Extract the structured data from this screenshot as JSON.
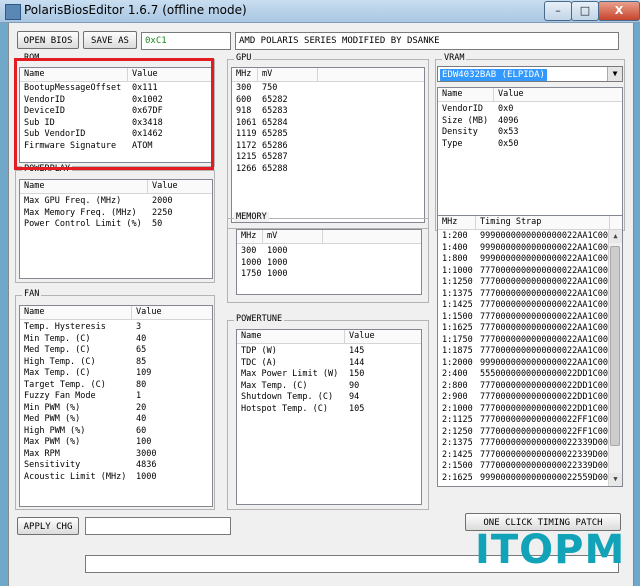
{
  "window": {
    "title": "PolarisBiosEditor 1.6.7 (offline mode)",
    "min": "–",
    "max": "□",
    "close": "X"
  },
  "toolbar": {
    "open_bios": "OPEN BIOS",
    "save_as": "SAVE AS",
    "checksum": "0xC1",
    "bios_name": "AMD POLARIS SERIES MODIFIED BY DSANKE"
  },
  "groups": {
    "rom": "ROM",
    "powerplay": "POWERPLAY",
    "fan": "FAN",
    "gpu": "GPU",
    "memory": "MEMORY",
    "powertune": "POWERTUNE",
    "vram": "VRAM"
  },
  "rom": {
    "headers": [
      "Name",
      "Value"
    ],
    "rows": [
      [
        "BootupMessageOffset",
        "0x111"
      ],
      [
        "VendorID",
        "0x1002"
      ],
      [
        "DeviceID",
        "0x67DF"
      ],
      [
        "Sub ID",
        "0x3418"
      ],
      [
        "Sub VendorID",
        "0x1462"
      ],
      [
        "Firmware Signature",
        "ATOM"
      ]
    ]
  },
  "powerplay": {
    "headers": [
      "Name",
      "Value"
    ],
    "rows": [
      [
        "Max GPU Freq. (MHz)",
        "2000"
      ],
      [
        "Max Memory Freq. (MHz)",
        "2250"
      ],
      [
        "Power Control Limit (%)",
        "50"
      ]
    ]
  },
  "fan": {
    "headers": [
      "Name",
      "Value"
    ],
    "rows": [
      [
        "Temp. Hysteresis",
        "3"
      ],
      [
        "Min Temp. (C)",
        "40"
      ],
      [
        "Med Temp. (C)",
        "65"
      ],
      [
        "High Temp. (C)",
        "85"
      ],
      [
        "Max Temp. (C)",
        "109"
      ],
      [
        "Target Temp. (C)",
        "80"
      ],
      [
        "Fuzzy Fan Mode",
        "1"
      ],
      [
        "Min PWM (%)",
        "20"
      ],
      [
        "Med PWM (%)",
        "40"
      ],
      [
        "High PWM (%)",
        "60"
      ],
      [
        "Max PWM (%)",
        "100"
      ],
      [
        "Max RPM",
        "3000"
      ],
      [
        "Sensitivity",
        "4836"
      ],
      [
        "Acoustic Limit (MHz)",
        "1000"
      ]
    ]
  },
  "gpu": {
    "headers": [
      "MHz",
      "mV"
    ],
    "rows": [
      [
        "300",
        "750"
      ],
      [
        "600",
        "65282"
      ],
      [
        "918",
        "65283"
      ],
      [
        "1061",
        "65284"
      ],
      [
        "1119",
        "65285"
      ],
      [
        "1172",
        "65286"
      ],
      [
        "1215",
        "65287"
      ],
      [
        "1266",
        "65288"
      ]
    ]
  },
  "memory": {
    "headers": [
      "MHz",
      "mV"
    ],
    "rows": [
      [
        "300",
        "1000"
      ],
      [
        "1000",
        "1000"
      ],
      [
        "1750",
        "1000"
      ]
    ]
  },
  "powertune": {
    "headers": [
      "Name",
      "Value"
    ],
    "rows": [
      [
        "TDP (W)",
        "145"
      ],
      [
        "TDC (A)",
        "144"
      ],
      [
        "Max Power Limit (W)",
        "150"
      ],
      [
        "Max Temp. (C)",
        "90"
      ],
      [
        "Shutdown Temp. (C)",
        "94"
      ],
      [
        "Hotspot Temp. (C)",
        "105"
      ]
    ]
  },
  "vram": {
    "selected": "EDW4032BAB (ELPIDA)",
    "headers": [
      "Name",
      "Value"
    ],
    "rows": [
      [
        "VendorID",
        "0x0"
      ],
      [
        "Size (MB)",
        "4096"
      ],
      [
        "Density",
        "0x53"
      ],
      [
        "Type",
        "0x50"
      ]
    ]
  },
  "timing": {
    "headers": [
      "MHz",
      "Timing Strap"
    ],
    "rows": [
      [
        "1:200",
        "9990000000000000022AA1C00"
      ],
      [
        "1:400",
        "9990000000000000022AA1C00"
      ],
      [
        "1:800",
        "9990000000000000022AA1C00"
      ],
      [
        "1:1000",
        "7770000000000000022AA1C00"
      ],
      [
        "1:1250",
        "7770000000000000022AA1C00"
      ],
      [
        "1:1375",
        "7770000000000000022AA1C00"
      ],
      [
        "1:1425",
        "7770000000000000022AA1C00"
      ],
      [
        "1:1500",
        "7770000000000000022AA1C00"
      ],
      [
        "1:1625",
        "7770000000000000022AA1C00"
      ],
      [
        "1:1750",
        "7770000000000000022AA1C00"
      ],
      [
        "1:1875",
        "7770000000000000022AA1C00"
      ],
      [
        "1:2000",
        "9990000000000000022AA1C00"
      ],
      [
        "2:400",
        "5550000000000000022DD1C00"
      ],
      [
        "2:800",
        "7770000000000000022DD1C00"
      ],
      [
        "2:900",
        "7770000000000000022DD1C00"
      ],
      [
        "2:1000",
        "7770000000000000022DD1C00"
      ],
      [
        "2:1125",
        "7770000000000000022FF1C00"
      ],
      [
        "2:1250",
        "7770000000000000022FF1C00"
      ],
      [
        "2:1375",
        "7770000000000000022339D00"
      ],
      [
        "2:1425",
        "7770000000000000022339D00"
      ],
      [
        "2:1500",
        "7770000000000000022339D00"
      ],
      [
        "2:1625",
        "9990000000000000022559D00"
      ]
    ]
  },
  "bottom": {
    "apply": "APPLY CHG",
    "one_click": "ONE CLICK TIMING PATCH"
  },
  "watermark": "ITOPM"
}
